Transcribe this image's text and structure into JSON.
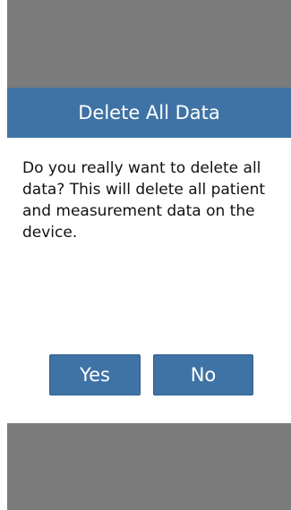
{
  "dialog": {
    "title": "Delete All Data",
    "message": "Do you really want to delete all data? This will delete all patient and measurement data on the device.",
    "buttons": {
      "yes": "Yes",
      "no": "No"
    }
  },
  "colors": {
    "overlay": "#7b7b7b",
    "dialog_header": "#3f73a6",
    "button": "#3f73a6",
    "dialog_background": "#ffffff",
    "text": "#111111"
  }
}
